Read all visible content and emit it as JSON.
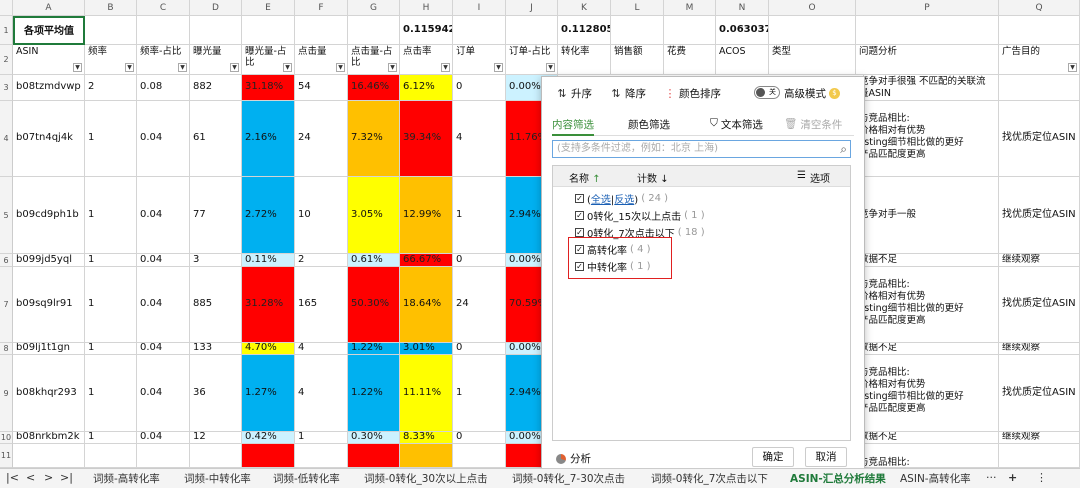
{
  "columns": [
    "A",
    "B",
    "C",
    "D",
    "E",
    "F",
    "G",
    "H",
    "I",
    "J",
    "K",
    "L",
    "M",
    "N",
    "O",
    "P",
    "Q"
  ],
  "row1": {
    "num": "1",
    "a": "各项平均值",
    "h": "0.115942",
    "k": "0.112805",
    "n": "0.063037"
  },
  "row2": {
    "num": "2",
    "headers": [
      "ASIN",
      "频率",
      "频率-占比",
      "曝光量",
      "曝光量-占比",
      "点击量",
      "点击量-占比",
      "点击率",
      "订单",
      "订单-占比",
      "转化率",
      "销售额",
      "花费",
      "ACOS",
      "类型",
      "问题分析",
      "广告目的"
    ]
  },
  "rows": [
    {
      "num": "3",
      "asin": "b08tzmdvwp",
      "freq": "2",
      "fr": "0.08",
      "exp": "882",
      "expr": "31.18%",
      "clk": "54",
      "clkr": "16.46%",
      "ctr": "6.12%",
      "ord": "0",
      "ordr": "0.00%",
      "p": "竞争对手很强\n不匹配的关联流量ASIN",
      "q": ""
    },
    {
      "num": "4",
      "asin": "b07tn4qj4k",
      "freq": "1",
      "fr": "0.04",
      "exp": "61",
      "expr": "2.16%",
      "clk": "24",
      "clkr": "7.32%",
      "ctr": "39.34%",
      "ord": "4",
      "ordr": "11.76%",
      "p": "与竞品相比:\n价格相对有优势\nlisting细节相比做的更好\n产品匹配度更高",
      "q": "找优质定位ASIN"
    },
    {
      "num": "5",
      "asin": "b09cd9ph1b",
      "freq": "1",
      "fr": "0.04",
      "exp": "77",
      "expr": "2.72%",
      "clk": "10",
      "clkr": "3.05%",
      "ctr": "12.99%",
      "ord": "1",
      "ordr": "2.94%",
      "p": "竞争对手一般",
      "q": "找优质定位ASIN"
    },
    {
      "num": "6",
      "asin": "b099jd5yql",
      "freq": "1",
      "fr": "0.04",
      "exp": "3",
      "expr": "0.11%",
      "clk": "2",
      "clkr": "0.61%",
      "ctr": "66.67%",
      "ord": "0",
      "ordr": "0.00%",
      "p": "数据不足",
      "q": "继续观察"
    },
    {
      "num": "7",
      "asin": "b09sq9lr91",
      "freq": "1",
      "fr": "0.04",
      "exp": "885",
      "expr": "31.28%",
      "clk": "165",
      "clkr": "50.30%",
      "ctr": "18.64%",
      "ord": "24",
      "ordr": "70.59%",
      "p": "与竞品相比:\n价格相对有优势\nlisting细节相比做的更好\n产品匹配度更高",
      "q": "找优质定位ASIN"
    },
    {
      "num": "8",
      "asin": "b09lj1t1gn",
      "freq": "1",
      "fr": "0.04",
      "exp": "133",
      "expr": "4.70%",
      "clk": "4",
      "clkr": "1.22%",
      "ctr": "3.01%",
      "ord": "0",
      "ordr": "0.00%",
      "p": "数据不足",
      "q": "继续观察"
    },
    {
      "num": "9",
      "asin": "b08khqr293",
      "freq": "1",
      "fr": "0.04",
      "exp": "36",
      "expr": "1.27%",
      "clk": "4",
      "clkr": "1.22%",
      "ctr": "11.11%",
      "ord": "1",
      "ordr": "2.94%",
      "p": "与竞品相比:\n价格相对有优势\nlisting细节相比做的更好\n产品匹配度更高",
      "q": "找优质定位ASIN"
    },
    {
      "num": "10",
      "asin": "b08nrkbm2k",
      "freq": "1",
      "fr": "0.04",
      "exp": "12",
      "expr": "0.42%",
      "clk": "1",
      "clkr": "0.30%",
      "ctr": "8.33%",
      "ord": "0",
      "ordr": "0.00%",
      "p": "数据不足",
      "q": "继续观察"
    },
    {
      "num": "11",
      "asin": "",
      "freq": "",
      "fr": "",
      "exp": "",
      "expr": "",
      "clk": "",
      "clkr": "",
      "ctr": "",
      "ord": "",
      "ordr": "",
      "p": "与竞品相比:",
      "q": ""
    }
  ],
  "dialog": {
    "sort_asc": "升序",
    "sort_desc": "降序",
    "color_sort": "颜色排序",
    "advanced_toggle": "关",
    "advanced_label": "高级模式",
    "tab_content": "内容筛选",
    "tab_color": "颜色筛选",
    "text_filter": "文本筛选",
    "clear": "清空条件",
    "search_placeholder": "(支持多条件过滤，例如：北京 上海)",
    "list_name": "名称",
    "list_count": "计数",
    "options": "选项",
    "select_all": "全选",
    "invert": "反选",
    "all_count": "( 24 )",
    "items": [
      {
        "label": "0转化_15次以上点击",
        "count": "( 1 )"
      },
      {
        "label": "0转化_7次点击以下",
        "count": "( 18 )"
      },
      {
        "label": "高转化率",
        "count": "( 4 )"
      },
      {
        "label": "中转化率",
        "count": "( 1 )"
      }
    ],
    "analyze": "分析",
    "ok": "确定",
    "cancel": "取消"
  },
  "sheet_tabs": [
    "词频-高转化率",
    "词频-中转化率",
    "词频-低转化率",
    "词频-0转化_30次以上点击",
    "词频-0转化_7-30次点击",
    "词频-0转化_7次点击以下",
    "ASIN-汇总分析结果",
    "ASIN-高转化率"
  ],
  "active_tab": "ASIN-汇总分析结果"
}
